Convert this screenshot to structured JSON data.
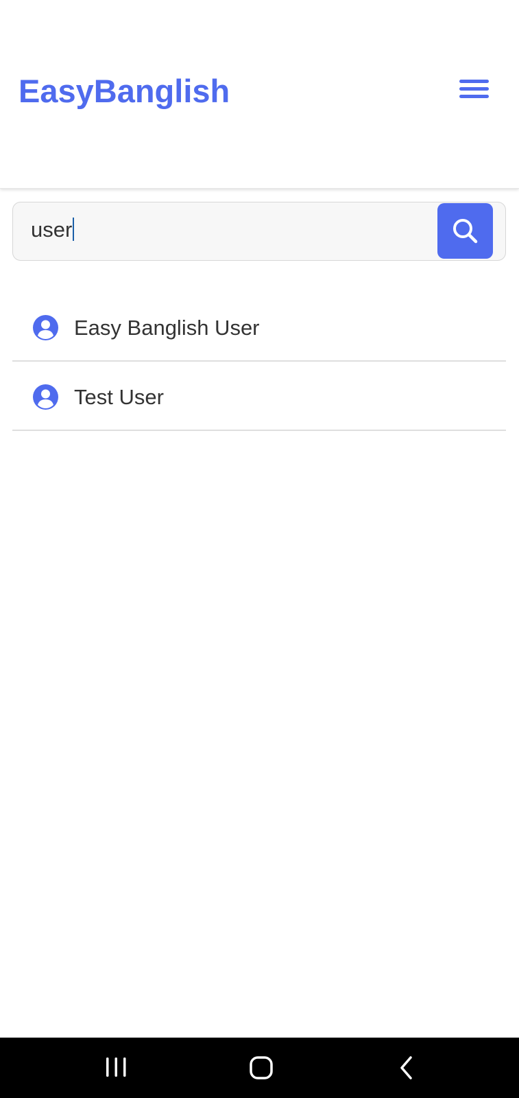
{
  "colors": {
    "brand": "#4f6bee",
    "accent": "#4f6bee",
    "text": "#333333",
    "divider": "#dedede",
    "nav_bar": "#000000"
  },
  "header": {
    "brand_name": "EasyBanglish",
    "menu_icon": "hamburger-menu-icon"
  },
  "search": {
    "value": "user",
    "button_icon": "search-icon"
  },
  "results": [
    {
      "icon": "user-avatar-icon",
      "name": "Easy Banglish User"
    },
    {
      "icon": "user-avatar-icon",
      "name": "Test User"
    }
  ],
  "system_nav": {
    "recent_icon": "recent-apps-icon",
    "home_icon": "home-icon",
    "back_icon": "back-icon"
  }
}
